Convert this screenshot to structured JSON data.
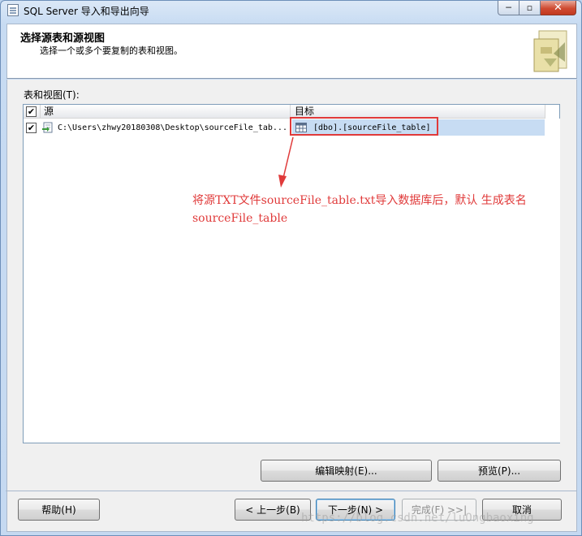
{
  "window": {
    "title": "SQL Server 导入和导出向导",
    "minimize": "─",
    "maximize": "▫",
    "close": "✕"
  },
  "header": {
    "title": "选择源表和源视图",
    "subtitle": "选择一个或多个要复制的表和视图。"
  },
  "tables_label": "表和视图(T):",
  "grid": {
    "columns": {
      "check": "✔",
      "source": "源",
      "destination": "目标"
    },
    "rows": [
      {
        "checked": "✔",
        "source": "C:\\Users\\zhwy20180308\\Desktop\\sourceFile_tab...",
        "destination": "[dbo].[sourceFile_table]"
      }
    ]
  },
  "annotation": {
    "line1": "将源TXT文件sourceFile_table.txt导入数据库后，默认 生成表名",
    "line2": "sourceFile_table",
    "color": "#e03a3a"
  },
  "buttons": {
    "edit_mappings": "编辑映射(E)...",
    "preview": "预览(P)...",
    "help": "帮助(H)",
    "back": "< 上一步(B)",
    "next": "下一步(N) >",
    "finish": "完成(F) >>|",
    "cancel": "取消"
  },
  "watermark": "https://blog.csdn.net/luOngbaoxing",
  "colors": {
    "window_frame": "#c5d9f1",
    "selected_row": "#c7dcf3",
    "annotation": "#e03a3a"
  }
}
